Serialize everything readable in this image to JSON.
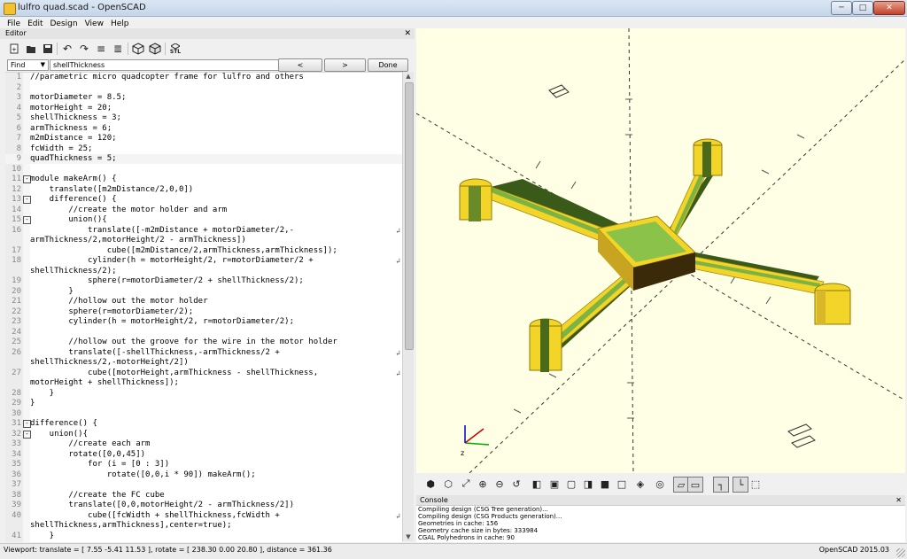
{
  "window": {
    "title": "lulfro quad.scad - OpenSCAD",
    "minimize": "─",
    "maximize": "□",
    "close": "✕"
  },
  "menu": [
    "File",
    "Edit",
    "Design",
    "View",
    "Help"
  ],
  "editor": {
    "header": "Editor",
    "close": "✕",
    "toolbar_icons": [
      "new-file-icon",
      "open-file-icon",
      "save-icon",
      "undo-icon",
      "redo-icon",
      "unindent-icon",
      "indent-icon",
      "preview-icon",
      "render-icon",
      "export-stl-icon"
    ],
    "export_label": "STL",
    "find": {
      "mode": "Find",
      "value": "shellThickness",
      "prev": "<",
      "next": ">",
      "done": "Done"
    },
    "lines": [
      {
        "n": "1",
        "t": "//parametric micro quadcopter frame for lulfro and others",
        "c": "cm"
      },
      {
        "n": "2",
        "t": ""
      },
      {
        "n": "3",
        "t": "motorDiameter = 8.5;"
      },
      {
        "n": "4",
        "t": "motorHeight = 20;"
      },
      {
        "n": "5",
        "t": "shellThickness = 3;"
      },
      {
        "n": "6",
        "t": "armThickness = 6;"
      },
      {
        "n": "7",
        "t": "m2mDistance = 120;"
      },
      {
        "n": "8",
        "t": "fcWidth = 25;"
      },
      {
        "n": "9",
        "t": "quadThickness = 5;",
        "hl": true
      },
      {
        "n": "10",
        "t": ""
      },
      {
        "n": "11",
        "t": "module makeArm() {",
        "fold": "-"
      },
      {
        "n": "12",
        "t": "    translate([m2mDistance/2,0,0])"
      },
      {
        "n": "13",
        "t": "    difference() {",
        "fold": "-"
      },
      {
        "n": "14",
        "t": "        //create the motor holder and arm",
        "c": "cm"
      },
      {
        "n": "15",
        "t": "        union(){",
        "fold": "-"
      },
      {
        "n": "16",
        "t": "            translate([-m2mDistance + motorDiameter/2,-",
        "w": "↲"
      },
      {
        "n": "",
        "t": "armThickness/2,motorHeight/2 - armThickness])"
      },
      {
        "n": "17",
        "t": "                cube([m2mDistance/2,armThickness,armThickness]);"
      },
      {
        "n": "18",
        "t": "            cylinder(h = motorHeight/2, r=motorDiameter/2 +",
        "w": "↲"
      },
      {
        "n": "",
        "t": "shellThickness/2);"
      },
      {
        "n": "19",
        "t": "            sphere(r=motorDiameter/2 + shellThickness/2);"
      },
      {
        "n": "20",
        "t": "        }"
      },
      {
        "n": "21",
        "t": "        //hollow out the motor holder",
        "c": "cm"
      },
      {
        "n": "22",
        "t": "        sphere(r=motorDiameter/2);"
      },
      {
        "n": "23",
        "t": "        cylinder(h = motorHeight/2, r=motorDiameter/2);"
      },
      {
        "n": "24",
        "t": ""
      },
      {
        "n": "25",
        "t": "        //hollow out the groove for the wire in the motor holder",
        "c": "cm"
      },
      {
        "n": "26",
        "t": "        translate([-shellThickness,-armThickness/2 +",
        "w": "↲"
      },
      {
        "n": "",
        "t": "shellThickness/2,-motorHeight/2])"
      },
      {
        "n": "27",
        "t": "            cube([motorHeight,armThickness - shellThickness,",
        "w": "↲"
      },
      {
        "n": "",
        "t": "motorHeight + shellThickness]);"
      },
      {
        "n": "28",
        "t": "    }"
      },
      {
        "n": "29",
        "t": "}"
      },
      {
        "n": "30",
        "t": ""
      },
      {
        "n": "31",
        "t": "difference() {",
        "fold": "-"
      },
      {
        "n": "32",
        "t": "    union(){",
        "fold": "-"
      },
      {
        "n": "33",
        "t": "        //create each arm",
        "c": "cm"
      },
      {
        "n": "34",
        "t": "        rotate([0,0,45])"
      },
      {
        "n": "35",
        "t": "            for (i = [0 : 3])"
      },
      {
        "n": "36",
        "t": "                rotate([0,0,i * 90]) makeArm();"
      },
      {
        "n": "37",
        "t": ""
      },
      {
        "n": "38",
        "t": "        //create the FC cube",
        "c": "cm"
      },
      {
        "n": "39",
        "t": "        translate([0,0,motorHeight/2 - armThickness/2])"
      },
      {
        "n": "40",
        "t": "            cube([fcWidth + shellThickness,fcWidth +",
        "w": "↲"
      },
      {
        "n": "",
        "t": "shellThickness,armThickness],center=true);"
      },
      {
        "n": "41",
        "t": "    }"
      }
    ]
  },
  "viewport": {
    "axes": {
      "x": "x",
      "y": "y",
      "z": "z"
    },
    "toolbar_icons": [
      "render-icon",
      "preview-icon",
      "view-all-icon",
      "zoom-in-icon",
      "zoom-out-icon",
      "reset-view-icon",
      "view-right-icon",
      "view-top-icon",
      "view-bottom-icon",
      "view-left-icon",
      "view-front-icon",
      "view-back-icon",
      "view-diagonal-icon",
      "view-center-icon",
      "perspective-icon",
      "orthogonal-icon",
      "show-axes-icon",
      "show-scale-icon",
      "show-edges-icon"
    ]
  },
  "console": {
    "header": "Console",
    "close": "✕",
    "lines": [
      "Compiling design (CSG Tree generation)...",
      "Compiling design (CSG Products generation)...",
      "Geometries in cache: 156",
      "Geometry cache size in bytes: 333984",
      "CGAL Polyhedrons in cache: 90"
    ]
  },
  "status": {
    "viewport": "Viewport: translate = [ 7.55 -5.41 11.53 ], rotate = [ 238.30 0.00 20.80 ], distance = 361.36",
    "version": "OpenSCAD 2015.03"
  },
  "colors": {
    "viewport_bg": "#ffffe5",
    "model_yellow": "#f3d52a",
    "model_green": "#8bc34a",
    "comment": "#1f8a9a"
  }
}
